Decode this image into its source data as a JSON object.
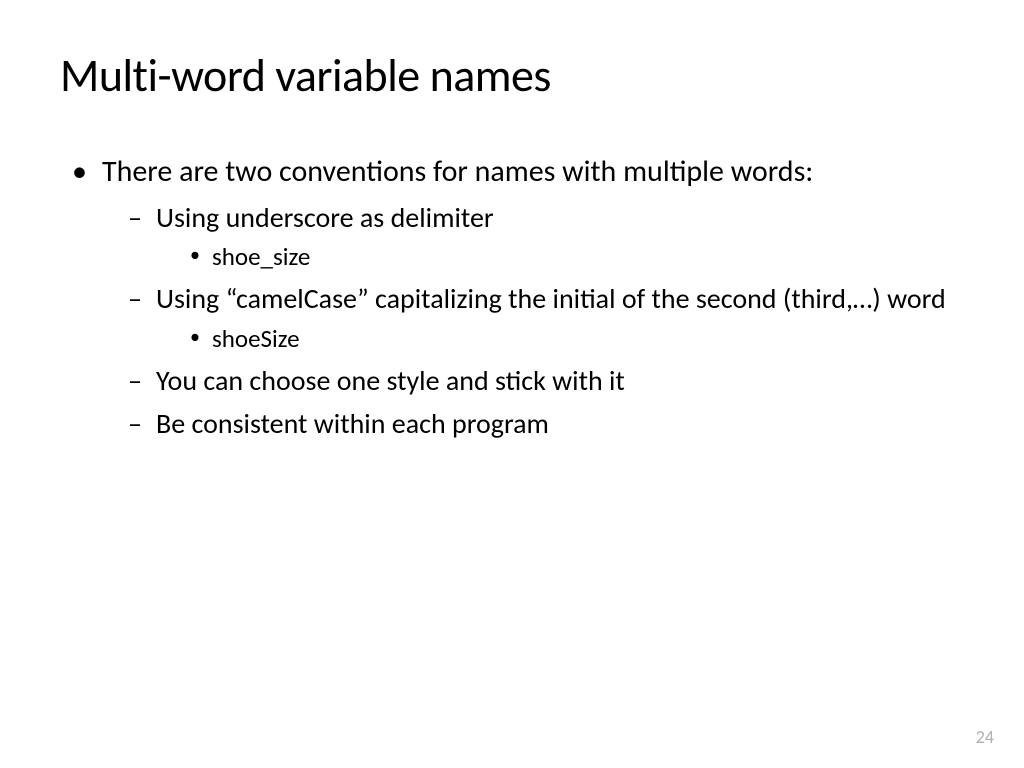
{
  "slide": {
    "title": "Multi-word variable names",
    "bullets": {
      "main": "There are two conventions for names with multiple words:",
      "sub1": "Using underscore as delimiter",
      "sub1_example": "shoe_size",
      "sub2": "Using “camelCase” capitalizing the initial of the second (third,…) word",
      "sub2_example": "shoeSize",
      "sub3": "You can choose one style and stick with it",
      "sub4": "Be consistent within each program"
    },
    "page_number": "24"
  }
}
